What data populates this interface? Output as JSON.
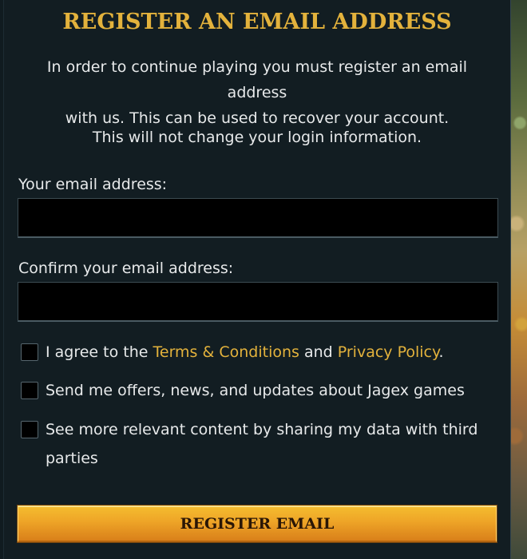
{
  "page": {
    "title": "REGISTER AN EMAIL ADDRESS",
    "intro_line1": "In order to continue playing you must register an email address",
    "intro_line2": "with us. This can be used to recover your account.",
    "notice": "This will not change your login information."
  },
  "form": {
    "email_label": "Your email address:",
    "email_value": "",
    "confirm_label": "Confirm your email address:",
    "confirm_value": "",
    "agree_prefix": "I agree to the ",
    "terms_link": "Terms & Conditions",
    "agree_middle": " and ",
    "privacy_link": "Privacy Policy",
    "agree_suffix": ".",
    "offers_label": "Send me offers, news, and updates about Jagex games",
    "share_label": "See more relevant content by sharing my data with third parties",
    "agree_checked": false,
    "offers_checked": false,
    "share_checked": false,
    "submit_label": "REGISTER EMAIL"
  },
  "colors": {
    "accent_gold": "#e3b23c",
    "panel_bg": "#121d22",
    "input_bg": "#000000",
    "button_gradient_top": "#f5bd2f",
    "button_gradient_bottom": "#d9801a"
  }
}
